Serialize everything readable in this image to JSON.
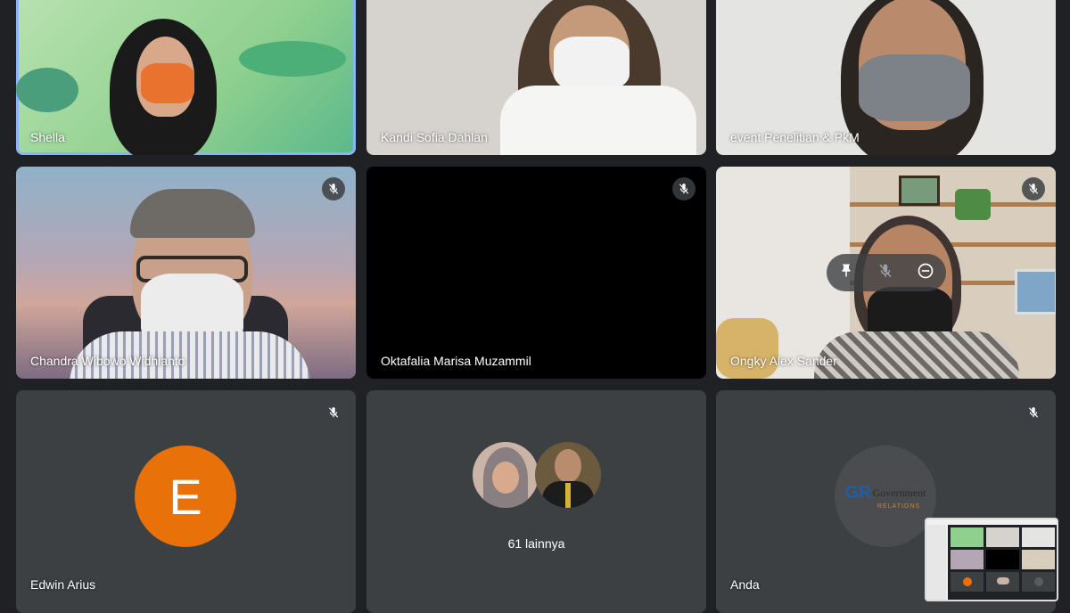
{
  "tiles": [
    {
      "name": "Shella"
    },
    {
      "name": "Kandi Sofia Dahlan"
    },
    {
      "name": "event Penelitian & PkM"
    },
    {
      "name": "Chandra Wibowo Widhianto"
    },
    {
      "name": "Oktafalia Marisa Muzammil"
    },
    {
      "name": "Ongky Alex Sander"
    },
    {
      "name": "Edwin Arius",
      "avatar_letter": "E",
      "avatar_color": "#e8710a"
    },
    {
      "more_label": "61 lainnya"
    },
    {
      "name": "Anda",
      "logo_text": "Government",
      "logo_sub": "RELATIONS",
      "logo_mark": "GR"
    }
  ],
  "colors": {
    "background": "#202124",
    "tile": "#3c4043",
    "active_outline": "#8ab4f8"
  },
  "icons": {
    "mute": "mic-off-icon",
    "pin": "pin-icon",
    "remove": "remove-icon"
  }
}
